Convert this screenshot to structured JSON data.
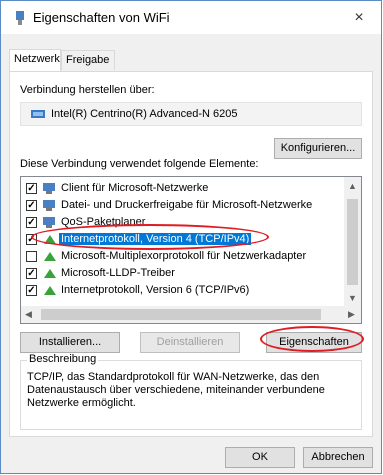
{
  "window": {
    "title": "Eigenschaften von WiFi",
    "close_symbol": "×"
  },
  "tabs": [
    {
      "label": "Netzwerk"
    },
    {
      "label": "Freigabe"
    }
  ],
  "connect_label": "Verbindung herstellen über:",
  "adapter": {
    "name": "Intel(R) Centrino(R) Advanced-N 6205"
  },
  "buttons": {
    "configure": "Konfigurieren...",
    "install": "Installieren...",
    "uninstall": "Deinstallieren",
    "properties": "Eigenschaften",
    "ok": "OK",
    "cancel": "Abbrechen"
  },
  "elements_label": "Diese Verbindung verwendet folgende Elemente:",
  "items": [
    {
      "label": "Client für Microsoft-Netzwerke",
      "checked": true,
      "icon": "network-client-icon"
    },
    {
      "label": "Datei- und Druckerfreigabe für Microsoft-Netzwerke",
      "checked": true,
      "icon": "network-service-icon"
    },
    {
      "label": "QoS-Paketplaner",
      "checked": true,
      "icon": "network-service-icon"
    },
    {
      "label": "Internetprotokoll, Version 4 (TCP/IPv4)",
      "checked": true,
      "selected": true,
      "icon": "protocol-icon"
    },
    {
      "label": "Microsoft-Multiplexorprotokoll für Netzwerkadapter",
      "checked": false,
      "icon": "protocol-icon"
    },
    {
      "label": "Microsoft-LLDP-Treiber",
      "checked": true,
      "icon": "protocol-icon"
    },
    {
      "label": "Internetprotokoll, Version 6 (TCP/IPv6)",
      "checked": true,
      "icon": "protocol-icon"
    }
  ],
  "description": {
    "legend": "Beschreibung",
    "text": "TCP/IP, das Standardprotokoll für WAN-Netzwerke, das den Datenaustausch über verschiedene, miteinander verbundene Netzwerke ermöglicht."
  },
  "colors": {
    "selection": "#0078d7",
    "annotation": "#e01b24"
  }
}
